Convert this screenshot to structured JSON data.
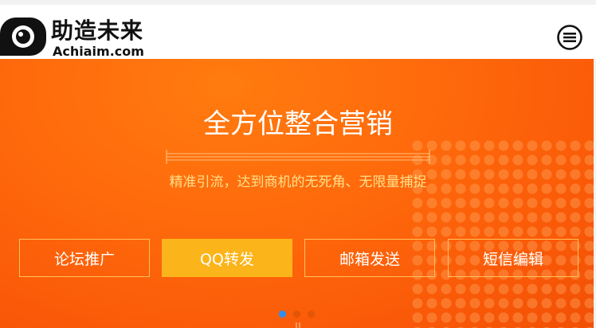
{
  "header": {
    "logo_title": "助造未来",
    "logo_subtitle": "Achiaim.com",
    "logo_icon": "camera-eye-logo",
    "menu_icon": "hamburger-menu-icon"
  },
  "hero": {
    "title": "全方位整合营销",
    "subtitle": "精准引流，达到商机的无死角、无限量捕捉",
    "buttons": [
      {
        "label": "论坛推广",
        "active": false
      },
      {
        "label": "QQ转发",
        "active": true
      },
      {
        "label": "邮箱发送",
        "active": false
      },
      {
        "label": "短信编辑",
        "active": false
      }
    ],
    "slides": 3,
    "active_slide": 1
  },
  "colors": {
    "hero_orange": "#ff6a0c",
    "subtitle_yellow": "#ffe08a",
    "button_active": "#fbb419",
    "button_border": "#ffc35a",
    "pager_active": "#2f8ef0"
  }
}
